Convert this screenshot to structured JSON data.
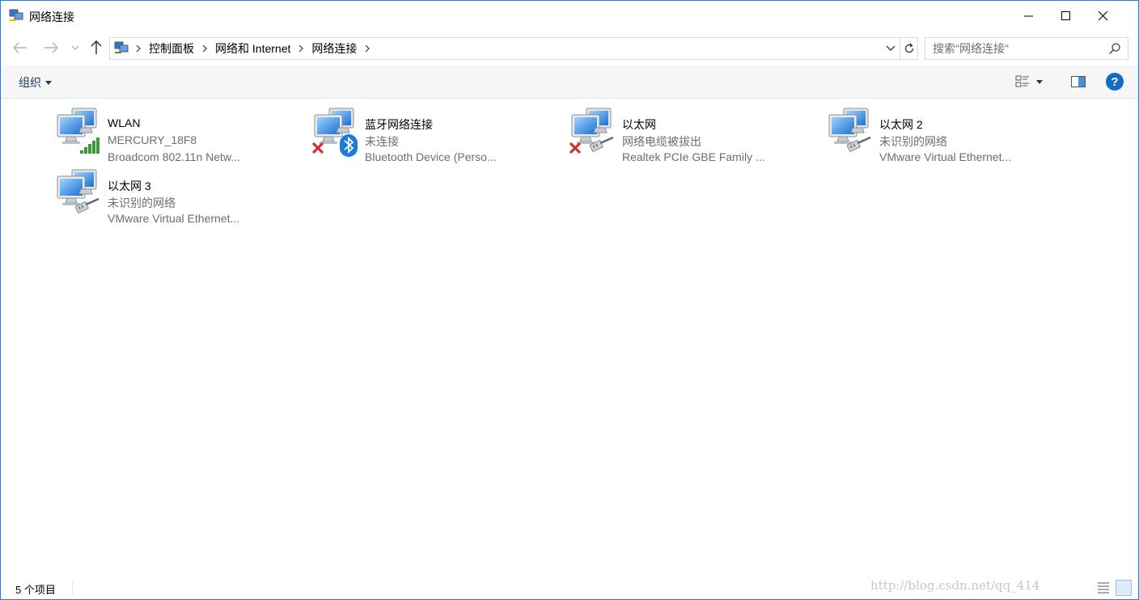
{
  "window": {
    "title": "网络连接",
    "controls": {
      "minimize": "minimize",
      "maximize": "maximize",
      "close": "close"
    }
  },
  "nav": {
    "breadcrumbs": [
      "控制面板",
      "网络和 Internet",
      "网络连接"
    ]
  },
  "search": {
    "placeholder": "搜索\"网络连接\""
  },
  "toolbar": {
    "organize_label": "组织",
    "help_label": "?"
  },
  "connections": [
    {
      "name": "WLAN",
      "status": "MERCURY_18F8",
      "device": "Broadcom 802.11n Netw...",
      "badge": "signal-bars",
      "disabled": false
    },
    {
      "name": "蓝牙网络连接",
      "status": "未连接",
      "device": "Bluetooth Device (Perso...",
      "badge": "bluetooth",
      "disabled": true
    },
    {
      "name": "以太网",
      "status": "网络电缆被拔出",
      "device": "Realtek PCIe GBE Family ...",
      "badge": "ethernet-cable",
      "disabled": true
    },
    {
      "name": "以太网 2",
      "status": "未识别的网络",
      "device": "VMware Virtual Ethernet...",
      "badge": "ethernet-cable",
      "disabled": false
    },
    {
      "name": "以太网 3",
      "status": "未识别的网络",
      "device": "VMware Virtual Ethernet...",
      "badge": "ethernet-cable",
      "disabled": false
    }
  ],
  "statusbar": {
    "item_count": "5 个项目",
    "watermark": "http://blog.csdn.net/qq_414"
  },
  "colors": {
    "accent": "#2b79d8",
    "help": "#1569c7",
    "error": "#d32f2f",
    "signal": "#3c9a3c",
    "bluetooth": "#1c7ad8"
  }
}
